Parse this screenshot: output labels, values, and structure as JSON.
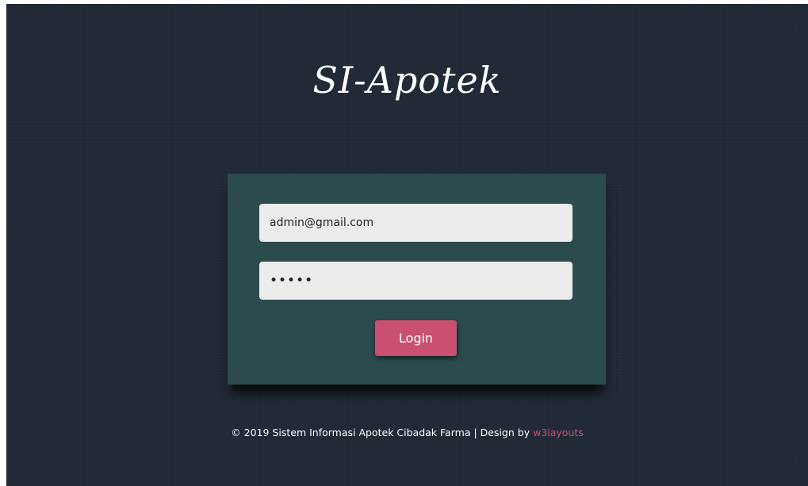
{
  "app": {
    "title": "SI-Apotek"
  },
  "login_form": {
    "email": {
      "value": "admin@gmail.com",
      "placeholder": ""
    },
    "password": {
      "value": "•••••",
      "placeholder": ""
    },
    "submit_label": "Login"
  },
  "footer": {
    "text": "© 2019 Sistem Informasi Apotek Cibadak Farma | Design by",
    "link_label": "w3layouts"
  },
  "colors": {
    "background": "#212a36",
    "panel": "#2c4b4d",
    "accent": "#c9506f",
    "input_bg": "#ececec"
  }
}
